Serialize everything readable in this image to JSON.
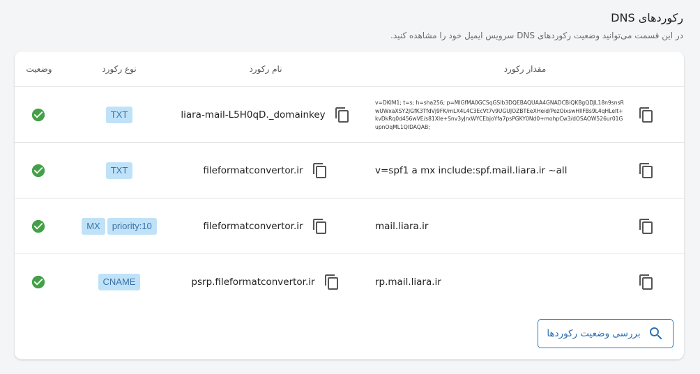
{
  "header": {
    "title": "رکوردهای DNS",
    "subtitle": "در این قسمت می‌توانید وضعیت رکوردهای DNS سرویس ایمیل خود را مشاهده کنید."
  },
  "table": {
    "columns": {
      "status": "وضعیت",
      "type": "نوع رکورد",
      "name": "نام رکورد",
      "value": "مقدار رکورد"
    },
    "rows": [
      {
        "status": "verified",
        "types": [
          "TXT"
        ],
        "name": "liara-mail-L5H0qD._domainkey",
        "value": "v=DKIM1; t=s; h=sha256; p=MIGfMA0GCSqGSIb3DQEBAQUAA4GNADCBiQKBgQDJL18n9snsRwUWxaXSY2JGfK3TfdVj9FK/mLX4L4C3EcVt7v9UGUJOZBTEeXHeid/PezOixswHllFBs9L4qHLeIt+kvDkRq0d456wVE/s81Xle+Snv3yJrxWYCEbjoYfa7psPGKY0Nd0+mohpCw3/dOSAOW526ur01GupnOqML1QIDAQAB;"
      },
      {
        "status": "verified",
        "types": [
          "TXT"
        ],
        "name": "fileformatconvertor.ir",
        "value": "v=spf1 a mx include:spf.mail.liara.ir ~all"
      },
      {
        "status": "verified",
        "types": [
          "MX",
          "priority:10"
        ],
        "name": "fileformatconvertor.ir",
        "value": "mail.liara.ir"
      },
      {
        "status": "verified",
        "types": [
          "CNAME"
        ],
        "name": "psrp.fileformatconvertor.ir",
        "value": "rp.mail.liara.ir"
      }
    ]
  },
  "check_button": {
    "label": "بررسی وضعیت رکوردها",
    "icon": "search-icon"
  },
  "colors": {
    "accent": "#2a6fb0",
    "success": "#43a047",
    "chip_bg": "#bfe2f8",
    "chip_text": "#3a72a8"
  }
}
